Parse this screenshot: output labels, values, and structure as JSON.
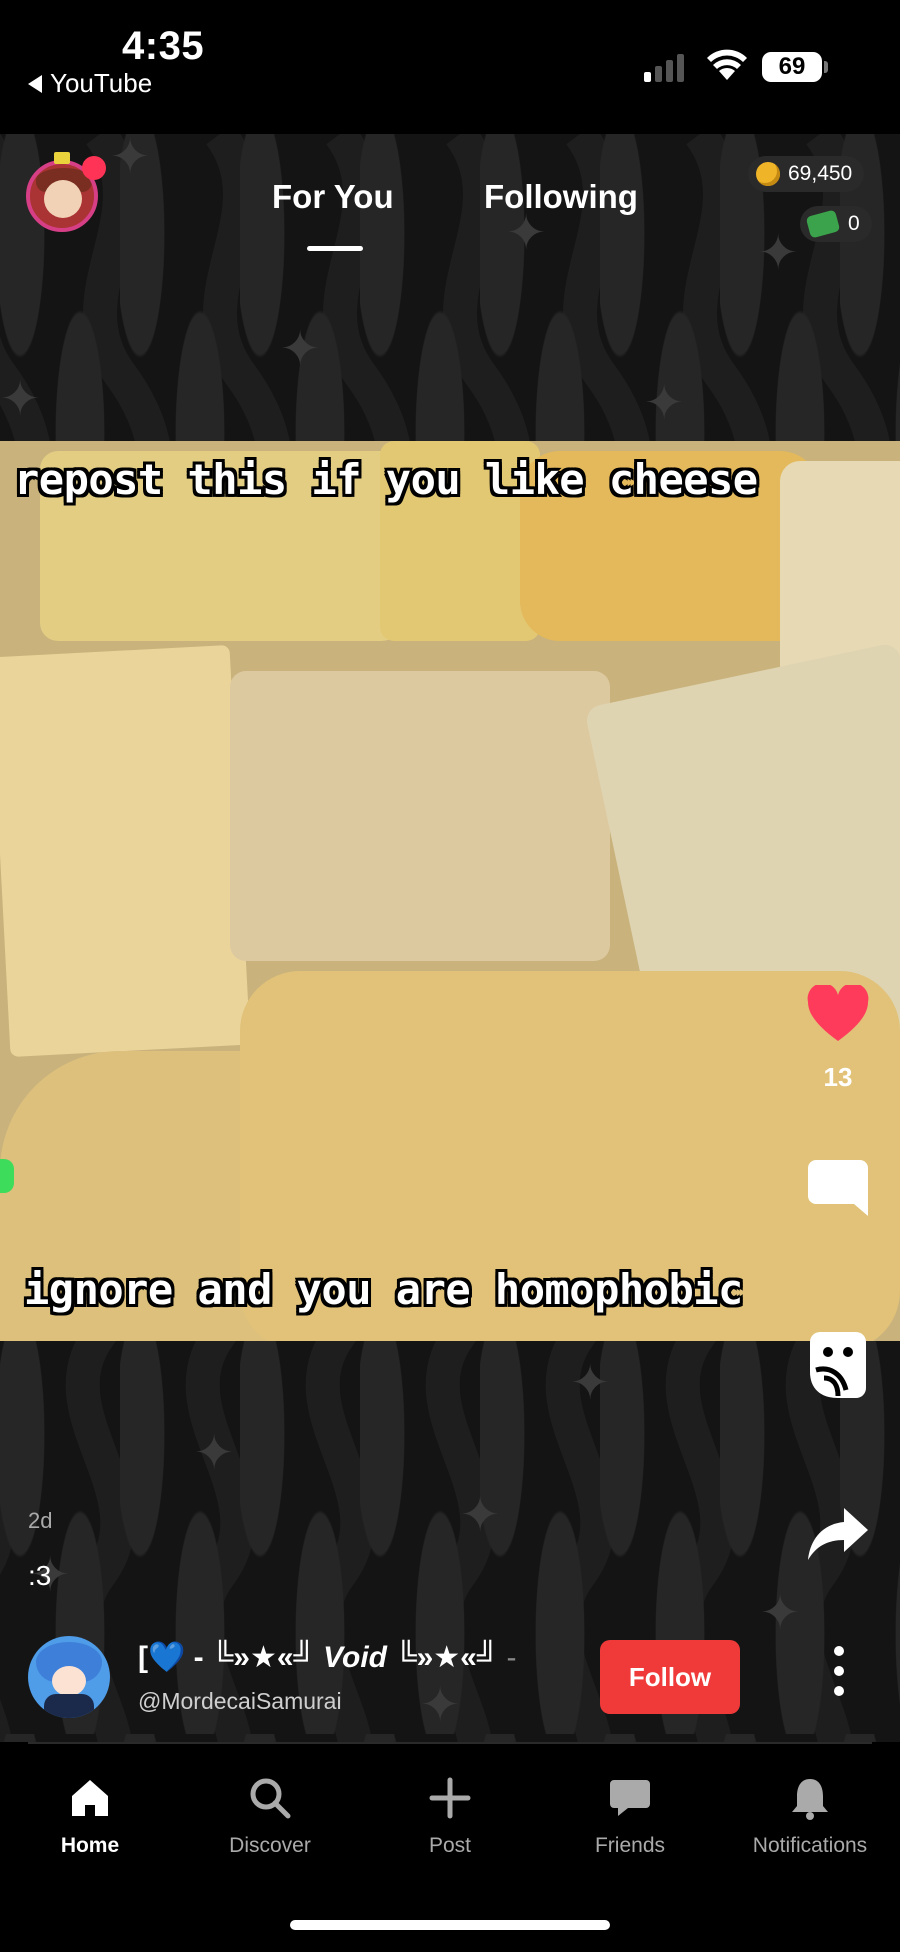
{
  "status_bar": {
    "time": "4:35",
    "back_app": "YouTube",
    "battery": "69"
  },
  "header": {
    "tabs": [
      {
        "label": "For You",
        "active": true
      },
      {
        "label": "Following",
        "active": false
      }
    ],
    "coins": "69,450",
    "cash": "0"
  },
  "video": {
    "caption_top": "repost this if you like cheese",
    "caption_bottom": "ignore and you are homophobic"
  },
  "actions": {
    "like_count": "13",
    "like_color": "#ff3b5c"
  },
  "post": {
    "age": "2d",
    "caption": ":3",
    "author_name_prefix": "[💙 - ╚»★«╝",
    "author_name_main": " Void ",
    "author_name_suffix": "╚»★«╝",
    "author_name_trail": " -",
    "author_handle": "@MordecaiSamurai",
    "follow_label": "Follow",
    "follow_color": "#f03a3a"
  },
  "nav": {
    "items": [
      {
        "label": "Home",
        "icon": "home-icon",
        "active": true
      },
      {
        "label": "Discover",
        "icon": "search-icon",
        "active": false
      },
      {
        "label": "Post",
        "icon": "plus-icon",
        "active": false
      },
      {
        "label": "Friends",
        "icon": "chat-bubble-icon",
        "active": false
      },
      {
        "label": "Notifications",
        "icon": "bell-icon",
        "active": false
      }
    ]
  }
}
